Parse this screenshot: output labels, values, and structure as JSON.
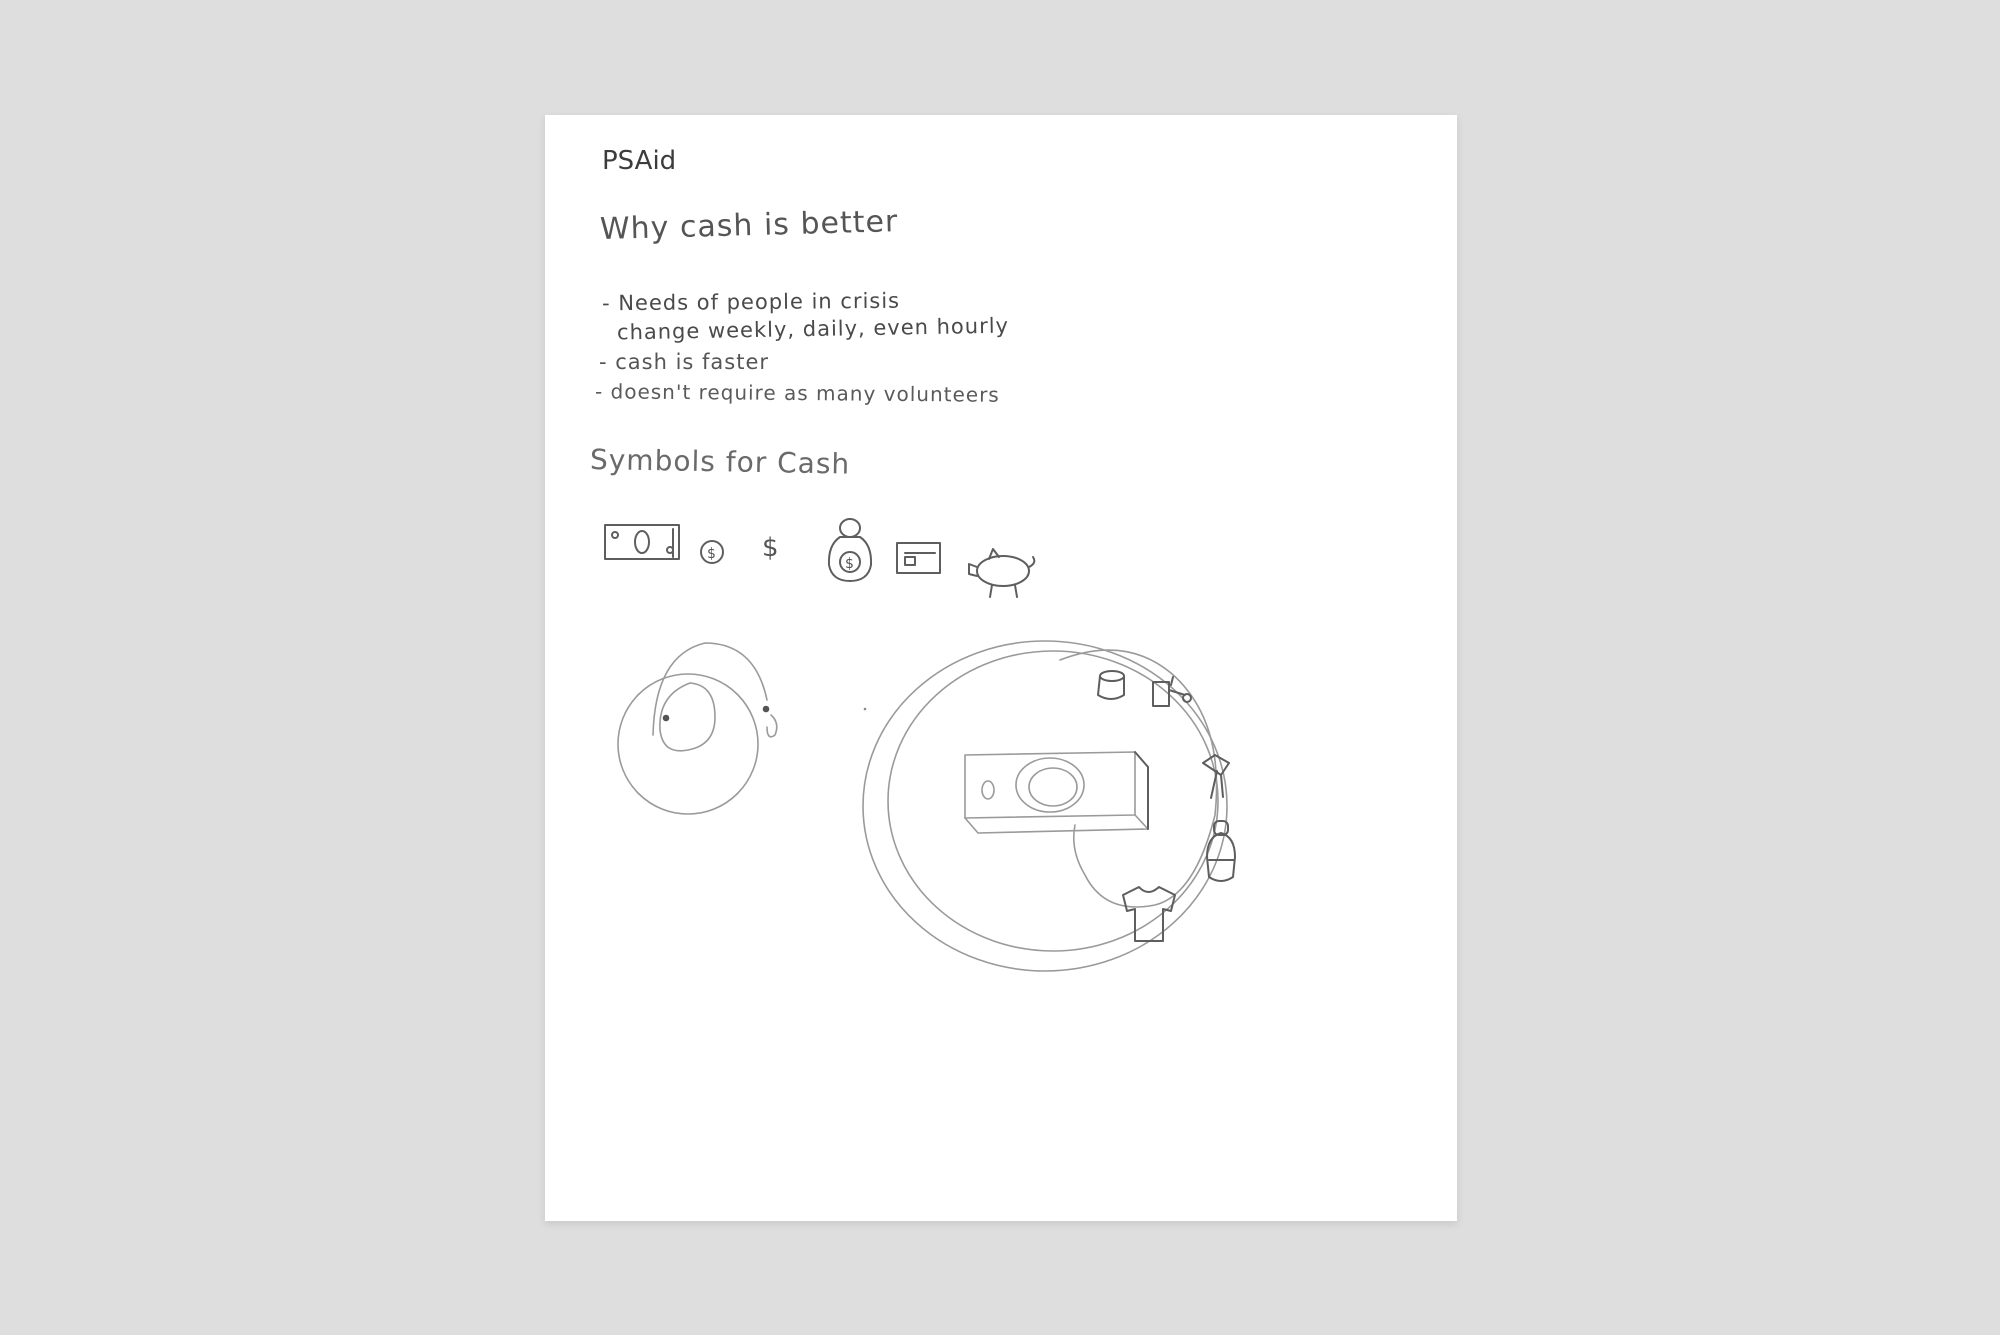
{
  "brand": "PSAid",
  "section_cash": {
    "heading": "Why cash is better",
    "bullets": [
      "- Needs of people in crisis",
      "change weekly, daily, even hourly",
      "- cash is faster",
      "- doesn't require as many volunteers"
    ]
  },
  "section_symbols": {
    "heading": "Symbols for Cash",
    "icons": [
      "banknote-icon",
      "coin-icon",
      "dollar-sign-icon",
      "money-bag-icon",
      "credit-card-icon",
      "piggy-bank-icon"
    ],
    "dollar_glyph": "$"
  },
  "sketches": [
    "person-headset-sketch",
    "cash-cycle-sketch"
  ],
  "colors": {
    "background": "#dedede",
    "paper": "#ffffff",
    "pencil": "#5e5e5e"
  }
}
